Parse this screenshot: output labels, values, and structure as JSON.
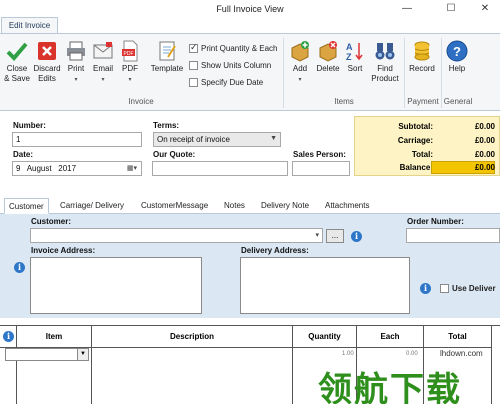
{
  "window": {
    "title": "Full Invoice View",
    "min": "—",
    "max": "☐",
    "close": "✕"
  },
  "ribbon": {
    "tab": "Edit Invoice",
    "buttons": {
      "close_save": [
        "Close",
        "& Save"
      ],
      "discard": [
        "Discard",
        "Edits"
      ],
      "print": "Print",
      "email": "Email",
      "pdf": "PDF",
      "template": "Template",
      "add": "Add",
      "delete": "Delete",
      "sort": "Sort",
      "find_product": [
        "Find",
        "Product"
      ],
      "record": "Record",
      "help": "Help"
    },
    "checks": {
      "print_qty": "Print Quantity & Each",
      "show_units": "Show Units Column",
      "specify_due": "Specify Due Date"
    },
    "groups": {
      "invoice": "Invoice",
      "items": "Items",
      "payment": "Payment",
      "general": "General"
    }
  },
  "form": {
    "number_label": "Number:",
    "number_value": "1",
    "terms_label": "Terms:",
    "terms_value": "On receipt of invoice",
    "date_label": "Date:",
    "date_day": "9",
    "date_month": "August",
    "date_year": "2017",
    "our_quote_label": "Our Quote:",
    "sales_person_label": "Sales Person:"
  },
  "totals": {
    "subtotal_label": "Subtotal:",
    "subtotal_value": "£0.00",
    "carriage_label": "Carriage:",
    "carriage_value": "£0.00",
    "total_label": "Total:",
    "total_value": "£0.00",
    "balance_label": "Balance:",
    "balance_value": "£0.00"
  },
  "tabs": [
    "Customer",
    "Carriage/ Delivery",
    "CustomerMessage",
    "Notes",
    "Delivery Note",
    "Attachments"
  ],
  "customer": {
    "customer_label": "Customer:",
    "browse": "...",
    "order_number_label": "Order Number:",
    "invoice_address_label": "Invoice Address:",
    "delivery_address_label": "Delivery Address:",
    "use_delivery_label": "Use Deliver"
  },
  "grid": {
    "headers": {
      "item": "Item",
      "description": "Description",
      "quantity": "Quantity",
      "each": "Each",
      "total": "Total"
    },
    "row1": {
      "qty": "1.00",
      "each": "0.00"
    }
  },
  "watermark": {
    "site": "lhdown.com",
    "text": "领航下载"
  }
}
